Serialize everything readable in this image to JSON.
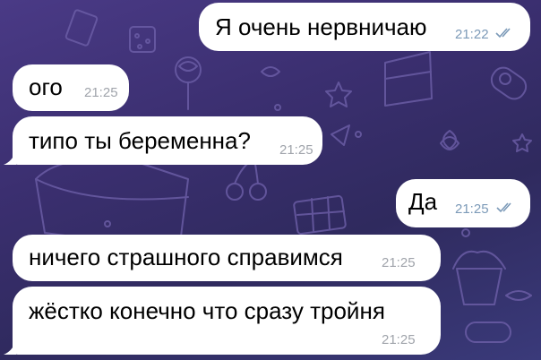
{
  "messages": [
    {
      "text": "Я очень нервничаю",
      "time": "21:22",
      "direction": "outgoing",
      "status": "read"
    },
    {
      "text": "ого",
      "time": "21:25",
      "direction": "incoming"
    },
    {
      "text": "типо ты беременна?",
      "time": "21:25",
      "direction": "incoming"
    },
    {
      "text": "Да",
      "time": "21:25",
      "direction": "outgoing",
      "status": "read"
    },
    {
      "text": "ничего страшного справимся",
      "time": "21:25",
      "direction": "incoming"
    },
    {
      "text": "жёстко конечно что сразу тройня",
      "time": "21:25",
      "direction": "incoming"
    }
  ],
  "colors": {
    "bubble": "#ffffff",
    "incoming_time": "#a0a4ab",
    "outgoing_time": "#7c9ab8",
    "wallpaper_top": "#4a3a86",
    "wallpaper_bottom": "#2f2a5e"
  },
  "icons": {
    "read_receipt": "double-check-icon"
  }
}
